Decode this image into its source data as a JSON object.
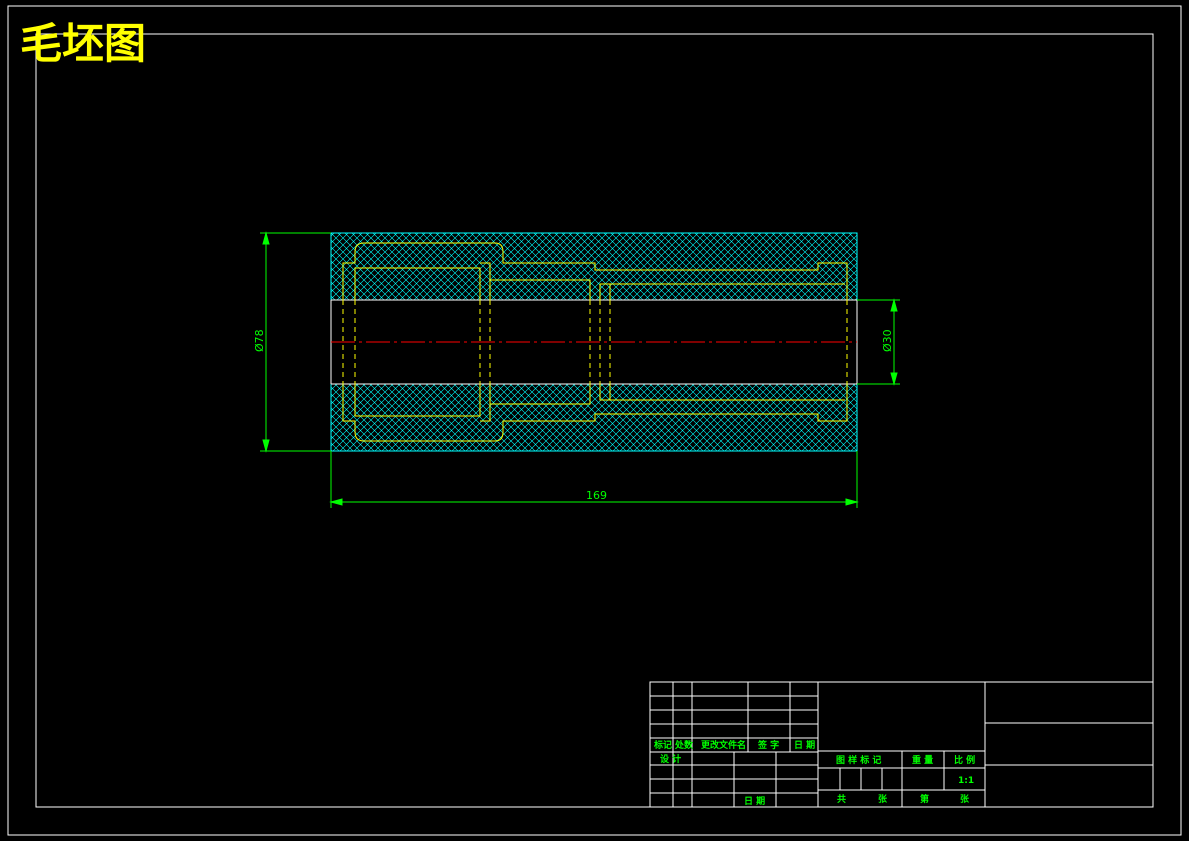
{
  "title": "毛坯图",
  "dimensions": {
    "outer_diameter": "Ø78",
    "inner_diameter": "Ø30",
    "length": "169"
  },
  "title_block": {
    "col_mark": "标记",
    "col_count": "处数",
    "col_change_doc": "更改文件名",
    "col_signature": "签 字",
    "col_date": "日 期",
    "designer": "设 计",
    "date": "日 期",
    "drawing_mark": "图 样 标 记",
    "weight": "重 量",
    "scale_label": "比 例",
    "scale_value": "1:1",
    "total": "共",
    "sheets_total": "张",
    "sheet_no": "第",
    "sheets_current": "张"
  },
  "colors": {
    "background": "#000000",
    "frame": "#ffffff",
    "title": "#ffff00",
    "dimension": "#00ff00",
    "hatch": "#00ffff",
    "part_outline": "#ffff00",
    "centerline": "#ff0000",
    "block_text": "#00ff00"
  }
}
